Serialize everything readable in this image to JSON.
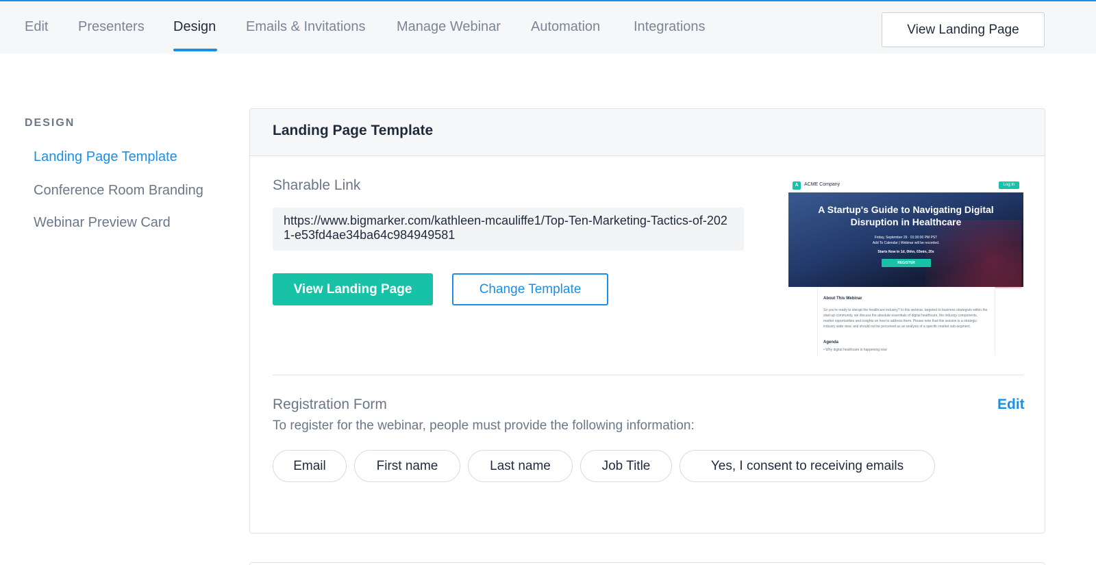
{
  "nav": {
    "tabs": [
      {
        "label": "Edit"
      },
      {
        "label": "Presenters"
      },
      {
        "label": "Design"
      },
      {
        "label": "Emails & Invitations"
      },
      {
        "label": "Manage Webinar"
      },
      {
        "label": "Automation"
      },
      {
        "label": "Integrations"
      }
    ],
    "active_tab": "Design",
    "view_landing_page": "View Landing Page"
  },
  "sidebar": {
    "heading": "DESIGN",
    "items": [
      {
        "label": "Landing Page Template",
        "active": true
      },
      {
        "label": "Conference Room Branding",
        "active": false
      },
      {
        "label": "Webinar Preview Card",
        "active": false
      }
    ]
  },
  "card": {
    "title": "Landing Page Template",
    "sharable_link_label": "Sharable Link",
    "sharable_link_value": "https://www.bigmarker.com/kathleen-mcauliffe1/Top-Ten-Marketing-Tactics-of-2021-e53fd4ae34ba64c984949581",
    "view_button": "View Landing Page",
    "change_button": "Change Template",
    "preview": {
      "logo_letter": "A",
      "company": "ACME Company",
      "login": "Log In",
      "title": "A Startup's Guide to Navigating Digital Disruption in Healthcare",
      "date": "Friday, September 29 · 01:30:00 PM PST",
      "calendar": "Add To Calendar  |  Webinar will be recorded.",
      "starts": "Starts Now in 1d, 0hhn, 03min, 20s",
      "register": "REGISTER",
      "about": "About This Webinar",
      "description": "So you're ready to disrupt the healthcare industry? In this webinar, targeted to business strategists within the start-up community, we discuss the absolute essentials of digital healthcare, the industry components, market opportunities and insights on how to address them. Please note that this session is a strategic industry wide view, and should not be perceived as an analysis of a specific market sub-segment.",
      "agenda": "Agenda",
      "bullet": "• Why digital healthcare is happening now"
    },
    "registration_label": "Registration Form",
    "edit_label": "Edit",
    "registration_desc": "To register for the webinar, people must provide the following information:",
    "fields": [
      "Email",
      "First name",
      "Last name",
      "Job Title",
      "Yes, I consent to receiving emails"
    ]
  },
  "colors": {
    "accent_blue": "#1a8fe3",
    "accent_teal": "#17c2a6",
    "text_dark": "#1f2a3c",
    "text_muted": "#6b7788"
  }
}
